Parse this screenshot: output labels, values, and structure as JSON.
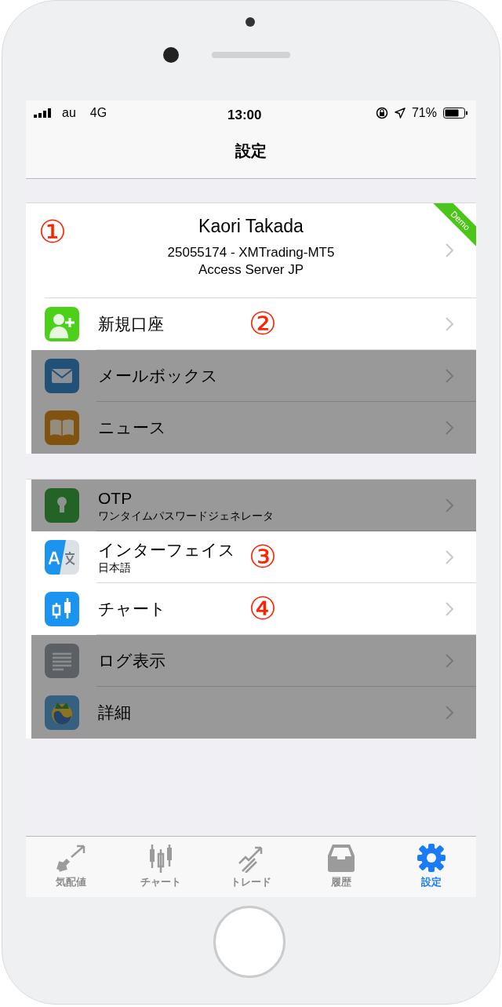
{
  "status_bar": {
    "carrier": "au",
    "network": "4G",
    "time": "13:00",
    "battery": "71%"
  },
  "nav_title": "設定",
  "account": {
    "name": "Kaori Takada",
    "login": "25055174 - XMTrading-MT5",
    "server": "Access Server JP",
    "badge": "Demo",
    "annotation": "①"
  },
  "sections": [
    {
      "items": [
        {
          "kind": "person-add",
          "title": "新規口座",
          "annotation": "②",
          "dimmed": false
        },
        {
          "kind": "mail",
          "title": "メールボックス",
          "dimmed": true
        },
        {
          "kind": "book",
          "title": "ニュース",
          "dimmed": true
        }
      ]
    },
    {
      "items": [
        {
          "kind": "keyhole",
          "title": "OTP",
          "subtitle": "ワンタイムパスワードジェネレータ",
          "dimmed": true
        },
        {
          "kind": "translate",
          "title": "インターフェイス",
          "subtitle": "日本語",
          "annotation": "③",
          "dimmed": false
        },
        {
          "kind": "candles",
          "title": "チャート",
          "annotation": "④",
          "dimmed": false
        },
        {
          "kind": "lines",
          "title": "ログ表示",
          "dimmed": true
        },
        {
          "kind": "globe",
          "title": "詳細",
          "dimmed": true
        }
      ]
    }
  ],
  "tab_bar": [
    {
      "kind": "quotes",
      "label": "気配値",
      "selected": false
    },
    {
      "kind": "chart",
      "label": "チャート",
      "selected": false
    },
    {
      "kind": "trade",
      "label": "トレード",
      "selected": false
    },
    {
      "kind": "history",
      "label": "履歴",
      "selected": false
    },
    {
      "kind": "settings",
      "label": "設定",
      "selected": true
    }
  ]
}
